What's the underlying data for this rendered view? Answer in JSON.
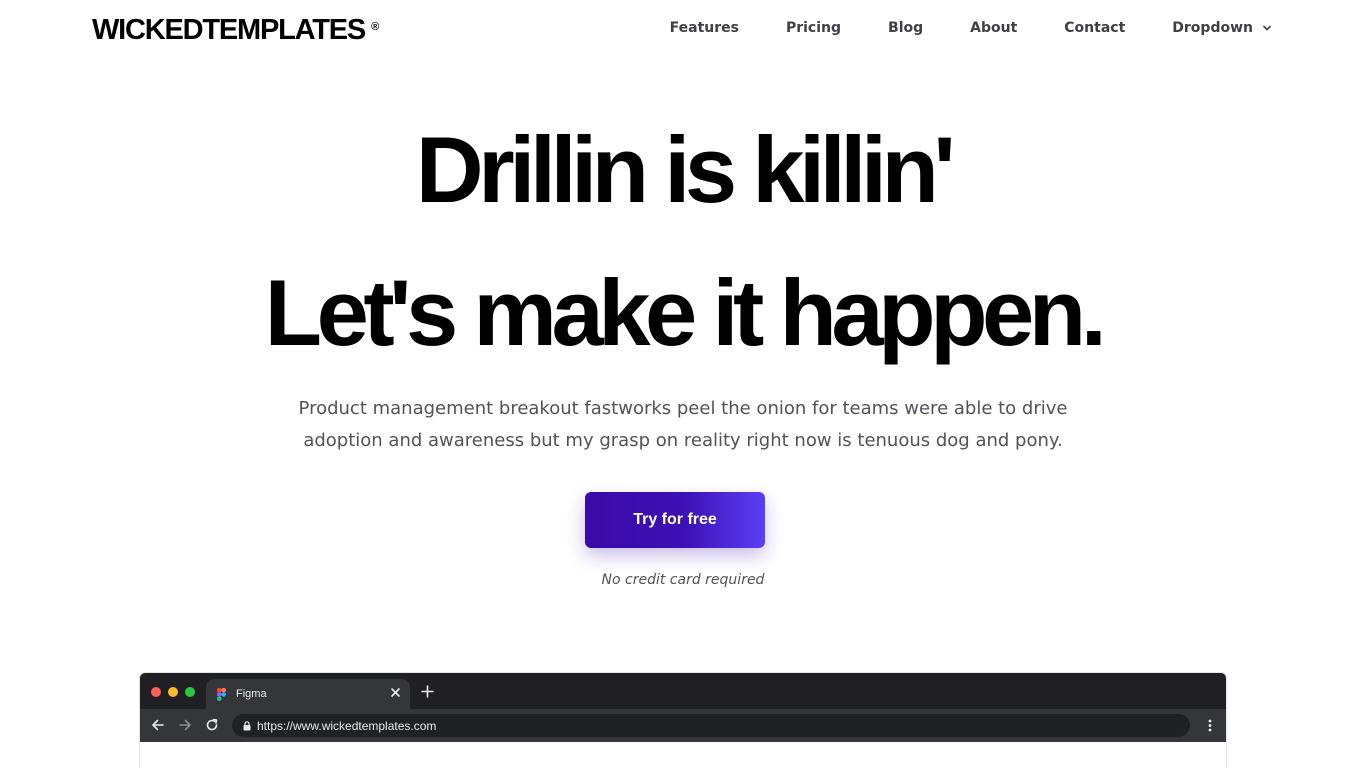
{
  "header": {
    "logo_text": "WICKEDTEMPLATES",
    "logo_mark": "®",
    "nav": {
      "features": "Features",
      "pricing": "Pricing",
      "blog": "Blog",
      "about": "About",
      "contact": "Contact",
      "dropdown": "Dropdown"
    }
  },
  "hero": {
    "title_line1": "Drillin is killin'",
    "title_line2": "Let's make it happen.",
    "subtitle_line1": "Product management breakout fastworks peel the onion for teams were able to drive",
    "subtitle_line2": "adoption and awareness but my grasp on reality right now is tenuous dog and pony.",
    "cta_label": "Try for free",
    "cta_note": "No credit card required"
  },
  "browser": {
    "tab_title": "Figma",
    "url": "https://www.wickedtemplates.com"
  },
  "colors": {
    "cta_start": "#3b0aa8",
    "cta_end": "#5b3ff6",
    "browser_chrome": "#1f1f24"
  },
  "icons": {
    "dropdown": "chevron-down-icon",
    "favicon": "figma-icon",
    "close": "close-icon",
    "new_tab": "plus-icon",
    "back": "arrow-left-icon",
    "forward": "arrow-right-icon",
    "reload": "reload-icon",
    "lock": "lock-icon",
    "menu": "more-vertical-icon"
  }
}
